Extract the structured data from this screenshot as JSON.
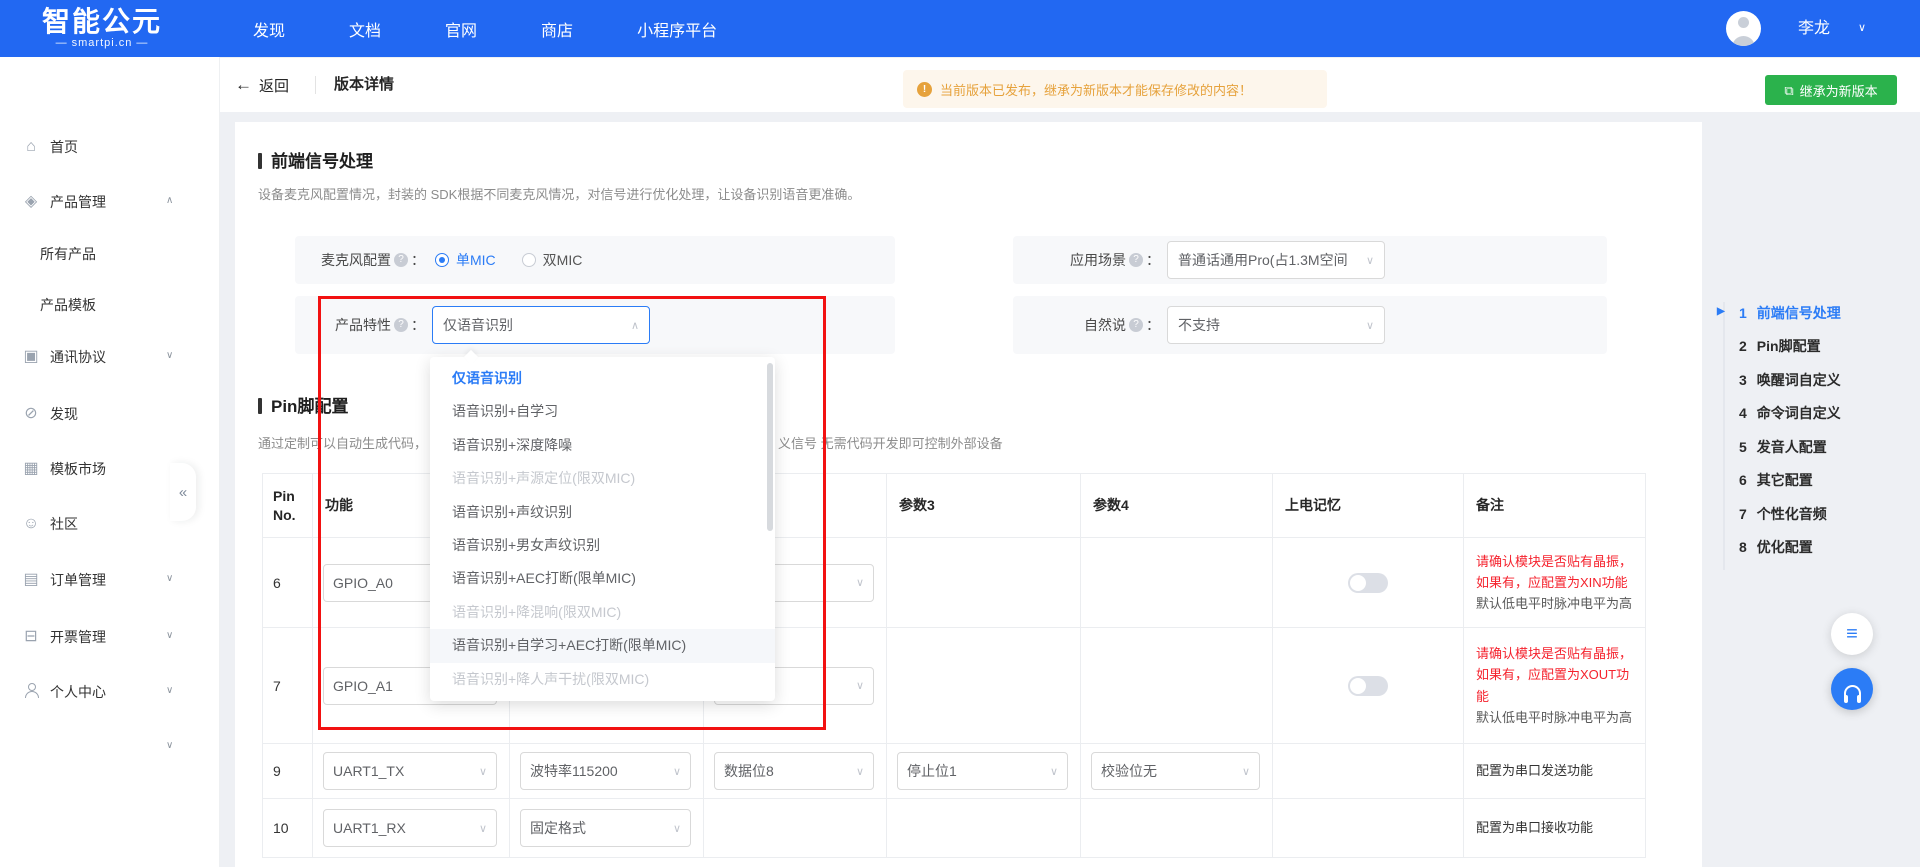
{
  "colors": {
    "topbar": "#2268f2",
    "accent": "#2b7cf6",
    "green": "#2bb24c",
    "warning_bg": "#fdf6ec",
    "warning_text": "#e6a23c",
    "remark_red": "#f5222d",
    "annotation_red": "#f21111"
  },
  "topbar": {
    "logo_title": "智能公元",
    "logo_subtitle": "— smartpi.cn —",
    "nav": [
      "发现",
      "文档",
      "官网",
      "商店",
      "小程序平台"
    ],
    "user_name": "李龙",
    "user_chevron": "∨"
  },
  "sidebar": {
    "collapse_glyph": "«",
    "items": [
      {
        "icon": "home-icon",
        "glyph": "⌂",
        "label": "首页"
      },
      {
        "icon": "layers-icon",
        "glyph": "◈",
        "label": "产品管理",
        "chevron": "up"
      },
      {
        "label": "所有产品",
        "sub": true
      },
      {
        "label": "产品模板",
        "sub": true
      },
      {
        "icon": "protocol-icon",
        "glyph": "▣",
        "label": "通讯协议",
        "chevron": "down"
      },
      {
        "icon": "discover-icon",
        "glyph": "⊘",
        "label": "发现"
      },
      {
        "icon": "template-market-icon",
        "glyph": "▦",
        "label": "模板市场"
      },
      {
        "icon": "community-icon",
        "glyph": "☺",
        "label": "社区"
      },
      {
        "icon": "order-icon",
        "glyph": "▤",
        "label": "订单管理",
        "chevron": "down"
      },
      {
        "icon": "invoice-icon",
        "glyph": "⊟",
        "label": "开票管理",
        "chevron": "down"
      },
      {
        "icon": "user-icon",
        "glyph": "person",
        "label": "个人中心",
        "chevron": "down"
      },
      {
        "label": "",
        "chevron": "down"
      }
    ]
  },
  "header": {
    "back_label": "返回",
    "back_arrow": "←",
    "title": "版本详情",
    "warning_mark": "!",
    "warning": "当前版本已发布，继承为新版本才能保存修改的内容！",
    "inherit_icon": "⧉",
    "inherit_button": "继承为新版本"
  },
  "section_signal": {
    "title": "前端信号处理",
    "desc": "设备麦克风配置情况，封装的 SDK根据不同麦克风情况，对信号进行优化处理，让设备识别语音更准确。",
    "help_mark": "?",
    "label_colon": "：",
    "mic_label": "麦克风配置",
    "mic_options": [
      {
        "label": "单MIC",
        "checked": true
      },
      {
        "label": "双MIC",
        "checked": false
      }
    ],
    "scene_label": "应用场景",
    "scene_value": "普通话通用Pro(占1.3M空间",
    "feature_label": "产品特性",
    "feature_value": "仅语音识别",
    "natural_label": "自然说",
    "natural_value": "不支持",
    "chevron_down": "∨",
    "chevron_up": "∧"
  },
  "feature_dropdown": {
    "options": [
      {
        "label": "仅语音识别",
        "state": "selected"
      },
      {
        "label": "语音识别+自学习",
        "state": "normal"
      },
      {
        "label": "语音识别+深度降噪",
        "state": "normal"
      },
      {
        "label": "语音识别+声源定位(限双MIC)",
        "state": "disabled"
      },
      {
        "label": "语音识别+声纹识别",
        "state": "normal"
      },
      {
        "label": "语音识别+男女声纹识别",
        "state": "normal"
      },
      {
        "label": "语音识别+AEC打断(限单MIC)",
        "state": "normal"
      },
      {
        "label": "语音识别+降混响(限双MIC)",
        "state": "disabled"
      },
      {
        "label": "语音识别+自学习+AEC打断(限单MIC)",
        "state": "hover"
      },
      {
        "label": "语音识别+降人声干扰(限双MIC)",
        "state": "disabled"
      }
    ]
  },
  "section_pin": {
    "title": "Pin脚配置",
    "desc_left": "通过定制可以自动生成代码，",
    "desc_right": "义信号 无需代码开发即可控制外部设备"
  },
  "pin_table": {
    "headers": [
      "Pin No.",
      "功能",
      "",
      "",
      "参数3",
      "参数4",
      "上电记忆",
      "备注"
    ],
    "rows": [
      {
        "pin": "6",
        "func": "GPIO_A0",
        "params": [
          null,
          {
            "value": ""
          },
          null,
          null
        ],
        "memory": "off",
        "remark_red": "请确认模块是否贴有晶振，如果有，应配置为XIN功能",
        "remark_gray": "默认低电平时脉冲电平为高"
      },
      {
        "pin": "7",
        "func": "GPIO_A1",
        "params": [
          null,
          {
            "value": ""
          },
          null,
          null
        ],
        "memory": "off",
        "remark_red": "请确认模块是否贴有晶振，如果有，应配置为XOUT功能",
        "remark_gray": "默认低电平时脉冲电平为高"
      },
      {
        "pin": "9",
        "func": "UART1_TX",
        "params": [
          {
            "value": "波特率115200"
          },
          {
            "value": "数据位8"
          },
          {
            "value": "停止位1"
          },
          {
            "value": "校验位无"
          }
        ],
        "memory": null,
        "remark_plain": "配置为串口发送功能"
      },
      {
        "pin": "10",
        "func": "UART1_RX",
        "params": [
          {
            "value": "固定格式"
          },
          null,
          null,
          null
        ],
        "memory": null,
        "remark_plain": "配置为串口接收功能"
      }
    ]
  },
  "anchor_nav": {
    "items": [
      {
        "num": "1",
        "label": "前端信号处理",
        "active": true
      },
      {
        "num": "2",
        "label": "Pin脚配置"
      },
      {
        "num": "3",
        "label": "唤醒词自定义"
      },
      {
        "num": "4",
        "label": "命令词自定义"
      },
      {
        "num": "5",
        "label": "发音人配置"
      },
      {
        "num": "6",
        "label": "其它配置"
      },
      {
        "num": "7",
        "label": "个性化音频"
      },
      {
        "num": "8",
        "label": "优化配置"
      }
    ]
  },
  "floating": {
    "list_icon_glyph": "≡"
  }
}
